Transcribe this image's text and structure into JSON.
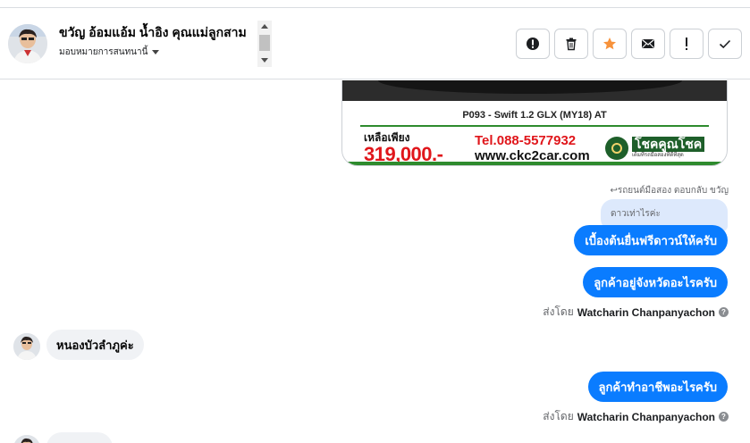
{
  "header": {
    "contact_name": "ขวัญ อ้อมแอ้ม น้ำอิง คุณแม่ลูกสาม",
    "assign_label": "มอบหมายการสนทนานี้",
    "actions": [
      {
        "name": "spam-button",
        "icon": "alert-circle-icon"
      },
      {
        "name": "delete-button",
        "icon": "trash-icon"
      },
      {
        "name": "star-button",
        "icon": "star-icon"
      },
      {
        "name": "mark-unread-button",
        "icon": "envelope-icon"
      },
      {
        "name": "follow-up-button",
        "icon": "exclamation-icon"
      },
      {
        "name": "mark-done-button",
        "icon": "check-icon"
      }
    ]
  },
  "ad": {
    "model": "P093 - Swift 1.2 GLX (MY18) AT",
    "remain_label": "เหลือเพียง",
    "price": "319,000.-",
    "tel": "Tel.088-5577932",
    "website": "www.ckc2car.com",
    "brand": "โชคคูณโชค",
    "tagline": "เต็มที่รถมือสองที่ดีที่สุด"
  },
  "conversation": {
    "reply_context": "รถยนต์มือสอง ตอบกลับ ขวัญ",
    "quoted_text": "ดาวเท่าไรค่ะ",
    "messages": [
      {
        "direction": "out",
        "text": "เบื้องต้นยื่นฟรีดาวน์ให้ครับ"
      },
      {
        "direction": "out",
        "text": "ลูกค้าอยู่จังหวัดอะไรครับ"
      },
      {
        "direction": "in",
        "text": "หนองบัวลำภูค่ะ"
      },
      {
        "direction": "out",
        "text": "ลูกค้าทำอาชีพอะไรครับ"
      }
    ],
    "sent_by_label": "ส่งโดย",
    "agent_name": "Watcharin Chanpanyachon",
    "help_glyph": "?"
  },
  "colors": {
    "outgoing_bubble": "#0a7cff",
    "incoming_bubble": "#f0f2f5",
    "star": "#f7923b",
    "price_red": "#e0161b",
    "brand_green": "#1e5f2a"
  }
}
